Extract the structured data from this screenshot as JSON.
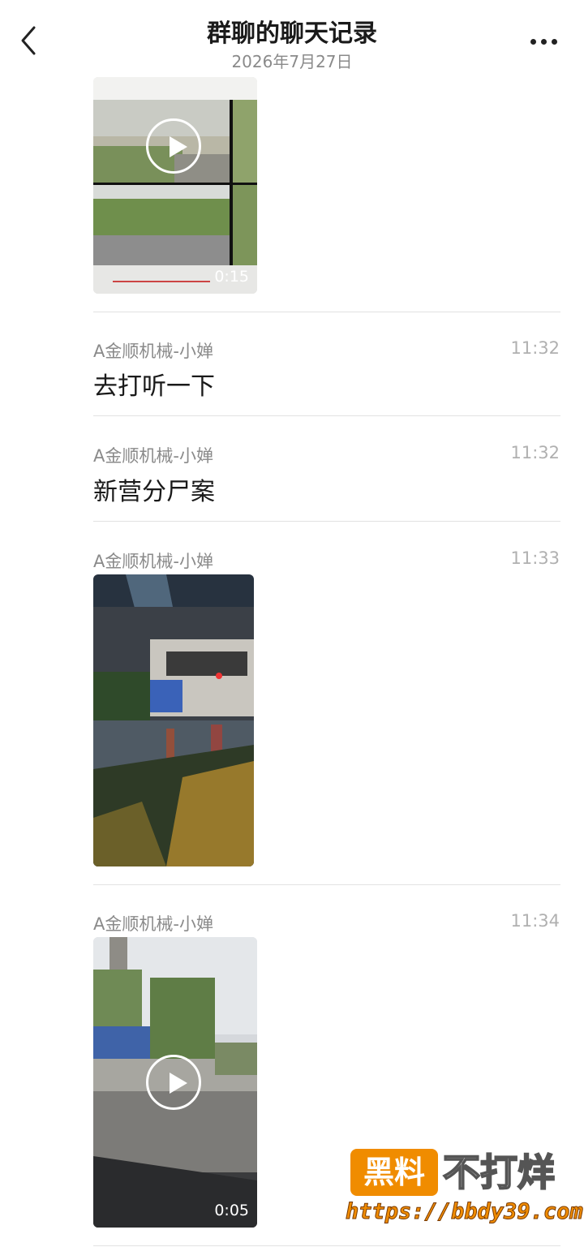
{
  "header": {
    "title": "群聊的聊天记录",
    "date": "2026年7月27日"
  },
  "icons": {
    "back": "chevron-left-icon",
    "more": "ellipsis-icon",
    "play": "play-icon"
  },
  "messages": [
    {
      "type": "video",
      "duration": "0:15"
    },
    {
      "type": "text",
      "sender": "A金顺机械-小婵",
      "time": "11:32",
      "text": "去打听一下"
    },
    {
      "type": "text",
      "sender": "A金顺机械-小婵",
      "time": "11:32",
      "text": "新营分尸案"
    },
    {
      "type": "image",
      "sender": "A金顺机械-小婵",
      "time": "11:33"
    },
    {
      "type": "video",
      "sender": "A金顺机械-小婵",
      "time": "11:34",
      "duration": "0:05"
    }
  ],
  "watermark": {
    "badge": "黑料",
    "text": "不打烊",
    "url": "https://bbdy39.com"
  }
}
